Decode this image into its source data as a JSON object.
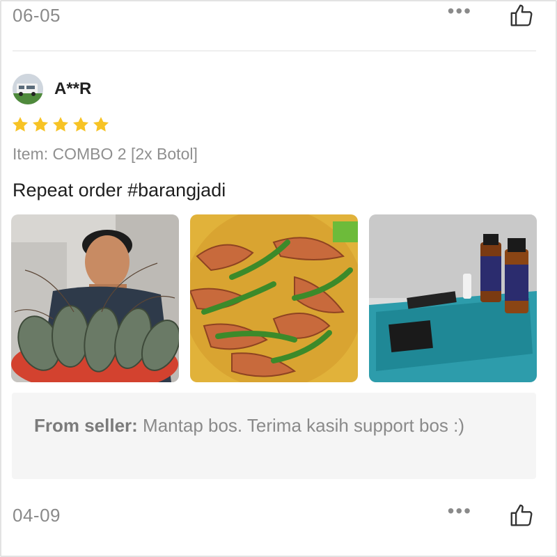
{
  "top_review": {
    "date": "06-05"
  },
  "review": {
    "username": "A**R",
    "rating": 5,
    "variant": "Item: COMBO 2 [2x Botol]",
    "comment": "Repeat order #barangjadi",
    "photos": [
      "boy-holding-prawns-photo",
      "cooked-prawn-curry-photo",
      "bottles-on-cooler-box-photo"
    ],
    "seller_reply_label": "From seller:",
    "seller_reply_text": " Mantap bos. Terima kasih support bos :)",
    "date": "04-09"
  },
  "icons": {
    "more": "more-dots-icon",
    "like": "thumbs-up-icon",
    "star": "star-icon"
  },
  "colors": {
    "star": "#f7c325",
    "text_muted": "#8a8a8a",
    "reply_bg": "#f5f5f5"
  }
}
